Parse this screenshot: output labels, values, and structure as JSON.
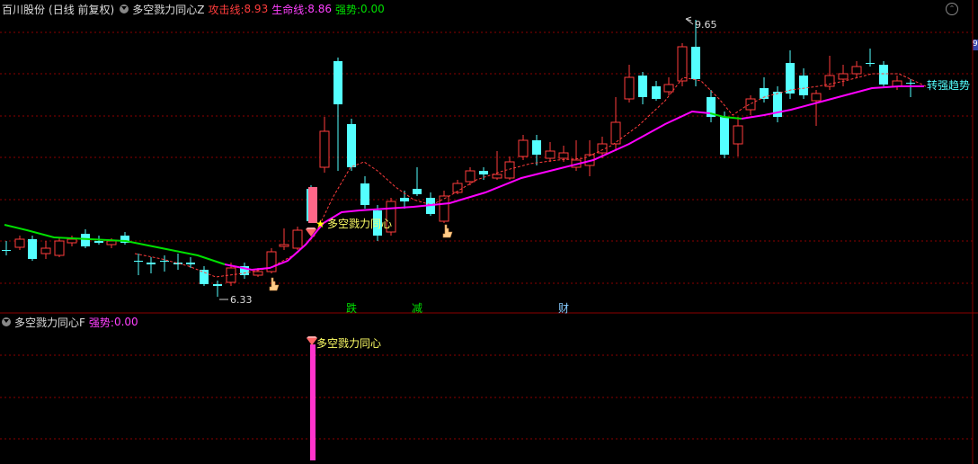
{
  "main_chart": {
    "stock_name": "百川股份",
    "period_adjust": "(日线 前复权)",
    "indicator_name": "多空戮力同心Z",
    "attack_label": "攻击线:",
    "attack_value": "8.93",
    "life_label": "生命线:",
    "life_value": "8.86",
    "strength_label": "强势:",
    "strength_value": "0.00",
    "high_label": "9.65",
    "low_label": "6.33",
    "trend_label": "转强趋势",
    "signal_label": "多空戮力同心",
    "markers": [
      "跌",
      "减",
      "财"
    ],
    "scale_tag": "9"
  },
  "sub_chart": {
    "indicator_name": "多空戮力同心F",
    "strength_label": "强势:",
    "strength_value": "0.00",
    "signal_label": "多空戮力同心"
  },
  "colors": {
    "up": "#ff3c3c",
    "down": "#54ffff",
    "attack": "#ff3c3c",
    "life_weak": "#00e000",
    "life_strong": "#ff00ff",
    "grid": "#8b0000"
  }
}
